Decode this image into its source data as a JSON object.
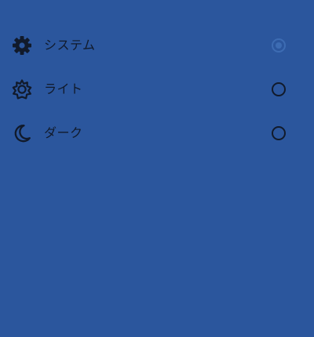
{
  "theme_options": [
    {
      "label": "システム",
      "icon": "gear-icon",
      "selected": true
    },
    {
      "label": "ライト",
      "icon": "sun-gear-outline-icon",
      "selected": false
    },
    {
      "label": "ダーク",
      "icon": "crescent-moon-icon",
      "selected": false
    }
  ],
  "colors": {
    "background": "#2b569d",
    "text": "#111a2b",
    "radio_selected": "#3d6cb3"
  }
}
